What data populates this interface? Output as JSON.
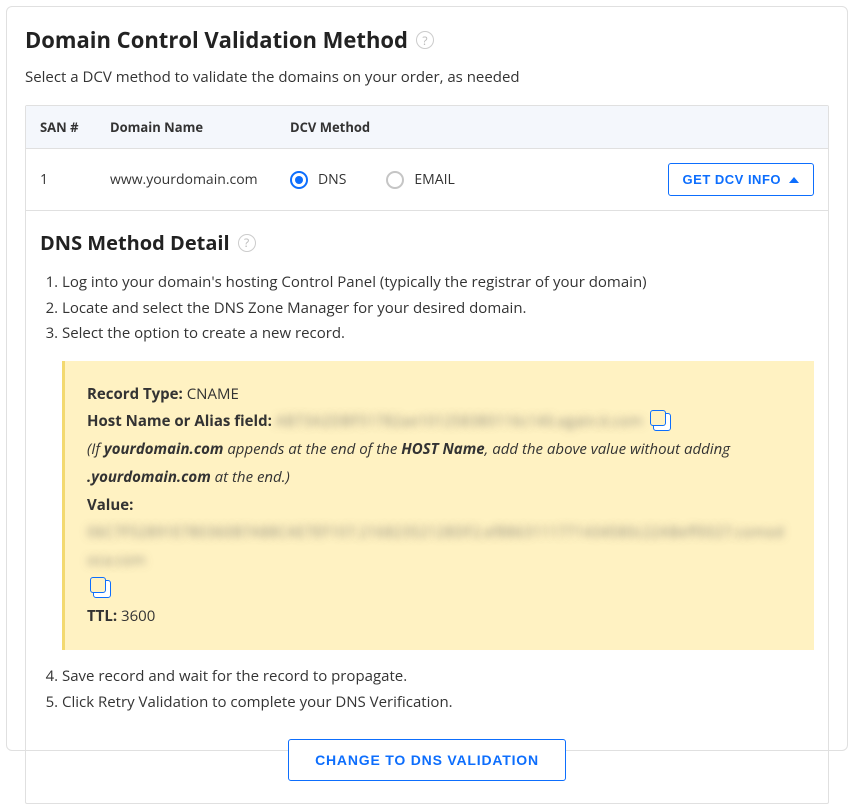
{
  "header": {
    "title": "Domain Control Validation Method",
    "subtitle": "Select a DCV method to validate the domains on your order, as needed"
  },
  "table": {
    "columns": {
      "san": "SAN #",
      "domain": "Domain Name",
      "method": "DCV Method"
    },
    "row": {
      "san": "1",
      "domain": "www.yourdomain.com",
      "option_dns": "DNS",
      "option_email": "EMAIL",
      "get_info_label": "GET DCV INFO"
    }
  },
  "detail": {
    "title": "DNS Method Detail",
    "step1": "Log into your domain's hosting Control Panel (typically the registrar of your domain)",
    "step2": "Locate and select the DNS Zone Manager for your desired domain.",
    "step3": "Select the option to create a new record.",
    "step4": "Save record and wait for the record to propagate.",
    "step5": "Click Retry Validation to complete your DNS Verification."
  },
  "dns": {
    "record_type_label": "Record Type:",
    "record_type_value": "CNAME",
    "host_label": "Host Name or Alias field:",
    "host_blur": "AB73A2DBF51782ae101258380116c140.again.it.com",
    "note_prefix": "(If ",
    "note_bold1": "yourdomain.com",
    "note_mid": " appends at the end of the ",
    "note_bold2": "HOST Name",
    "note_mid2": ", add the above value without adding ",
    "note_bold3": ".yourdomain.com",
    "note_suffix": " at the end.)",
    "value_label": "Value:",
    "value_blur": "06C7F52891E780360B7A88CAE7EF107.21682352128DF2.ef8863111771434580c22ABeff0027.comodoca.com",
    "ttl_label": "TTL:",
    "ttl_value": "3600"
  },
  "actions": {
    "change_button": "CHANGE TO DNS VALIDATION"
  }
}
